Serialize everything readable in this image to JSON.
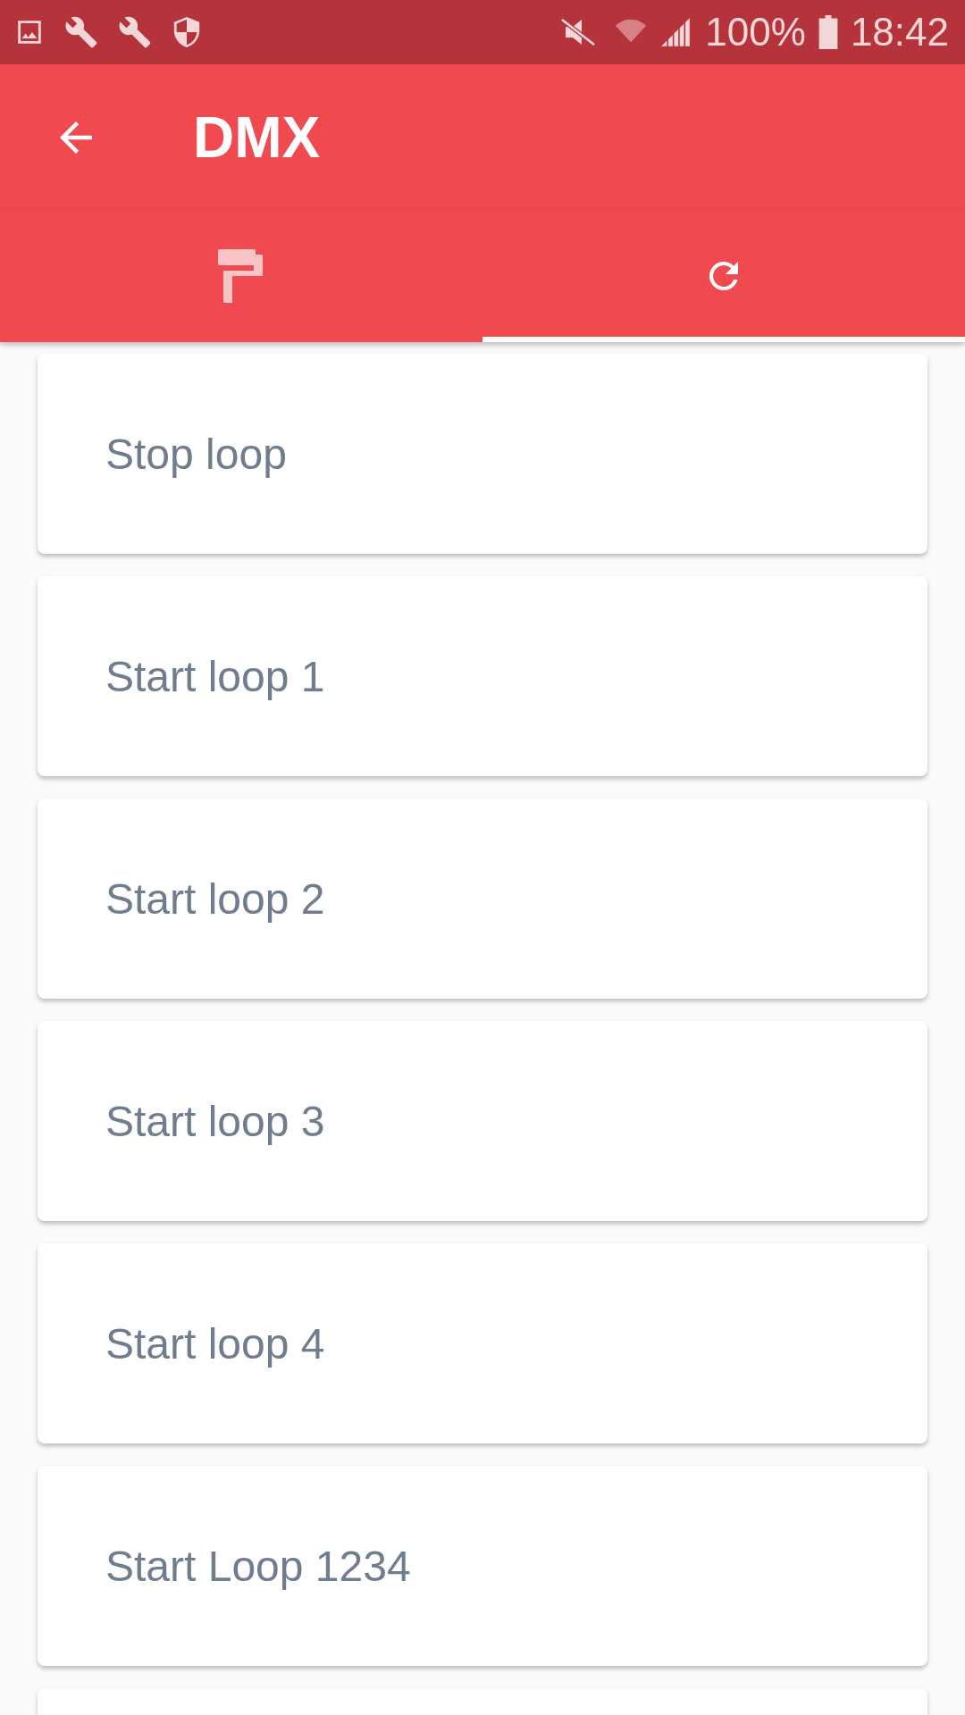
{
  "status_bar": {
    "battery": "100%",
    "time": "18:42"
  },
  "app_bar": {
    "title": "DMX"
  },
  "tabs": [
    {
      "kind": "paint",
      "selected": false
    },
    {
      "kind": "refresh",
      "selected": true
    }
  ],
  "items": [
    {
      "label": "Stop loop"
    },
    {
      "label": "Start loop 1"
    },
    {
      "label": "Start loop 2"
    },
    {
      "label": "Start loop 3"
    },
    {
      "label": "Start loop 4"
    },
    {
      "label": "Start Loop 1234"
    }
  ]
}
